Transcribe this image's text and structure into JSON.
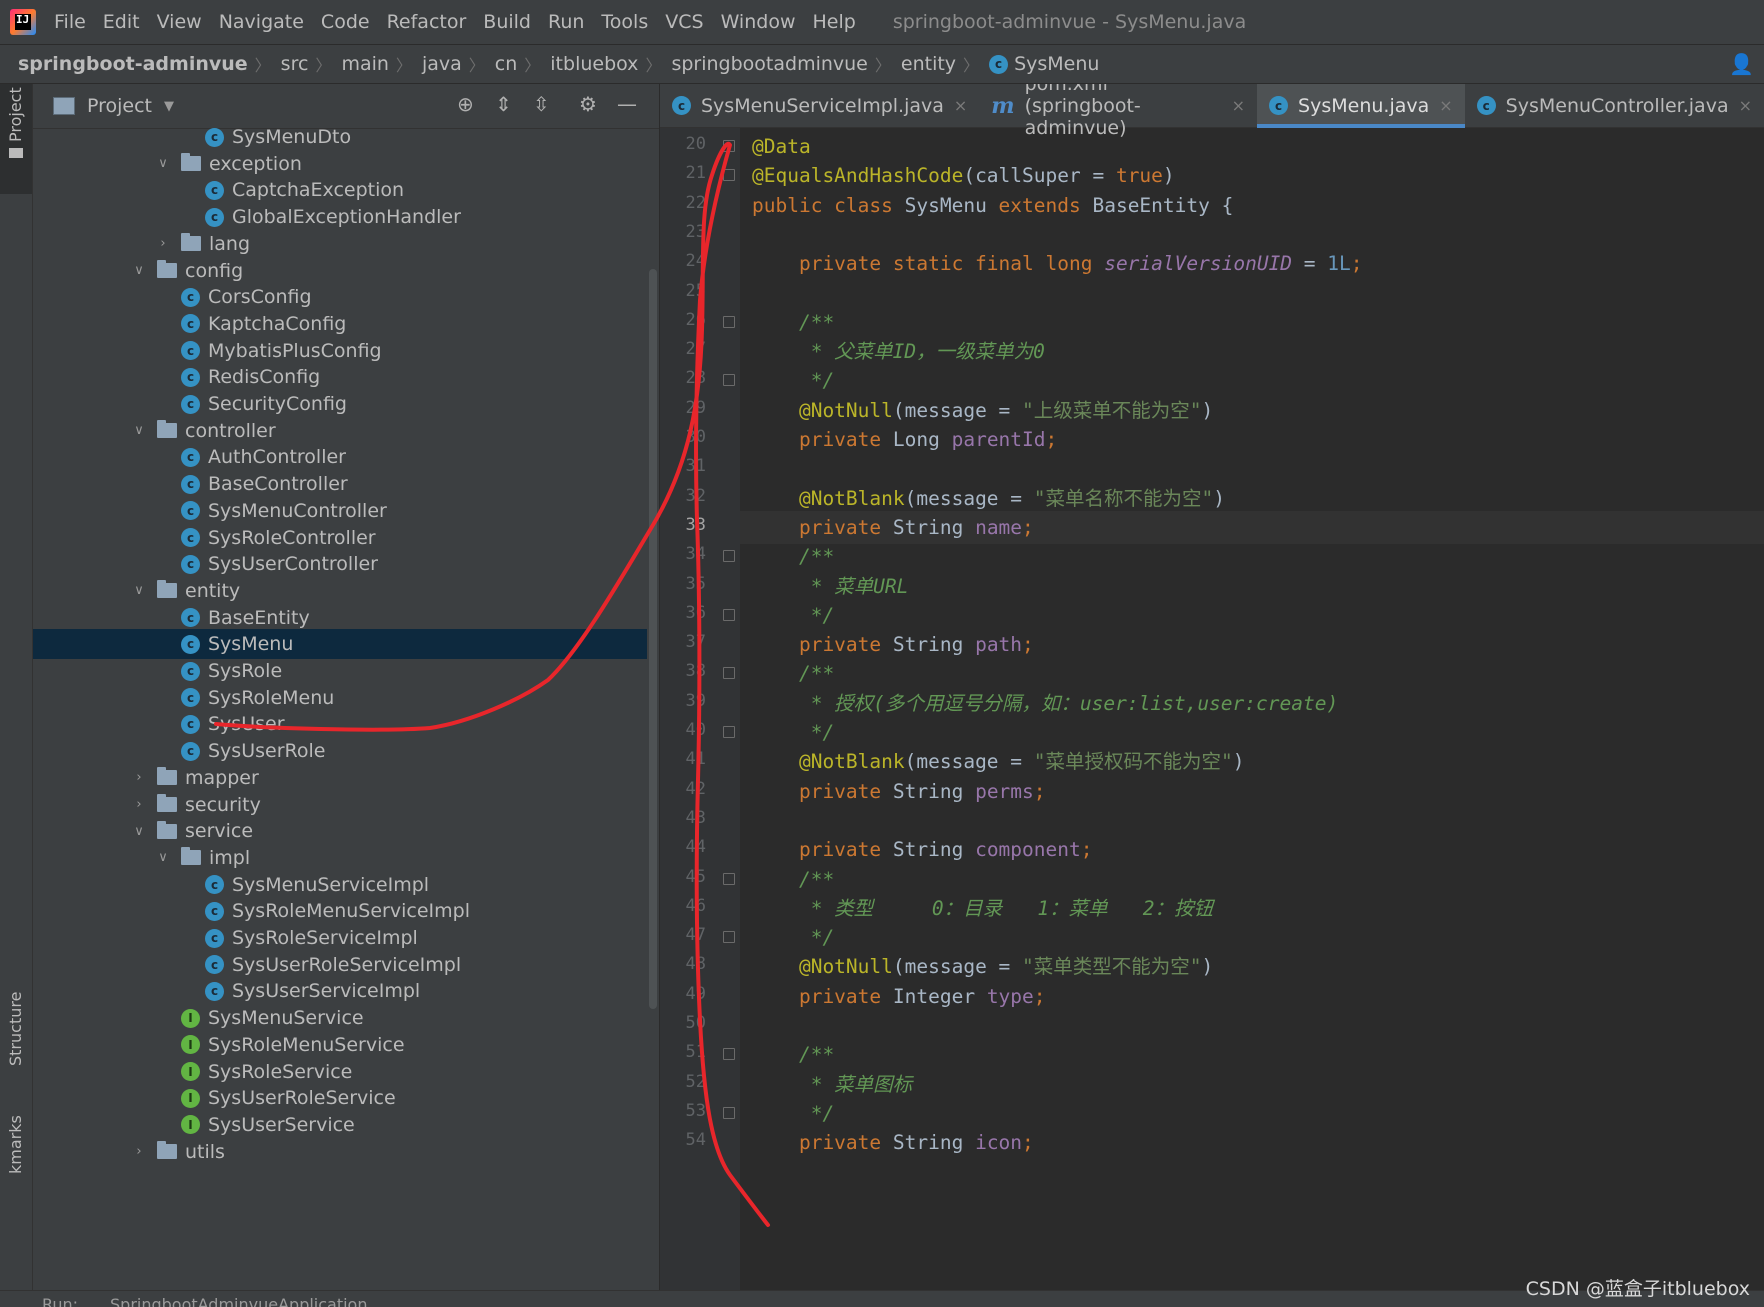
{
  "menu": {
    "items": [
      "File",
      "Edit",
      "View",
      "Navigate",
      "Code",
      "Refactor",
      "Build",
      "Run",
      "Tools",
      "VCS",
      "Window",
      "Help"
    ],
    "window_title": "springboot-adminvue - SysMenu.java"
  },
  "breadcrumb": [
    "springboot-adminvue",
    "src",
    "main",
    "java",
    "cn",
    "itbluebox",
    "springbootadminvue",
    "entity",
    "SysMenu"
  ],
  "tool_strip": {
    "project": "Project",
    "structure": "Structure",
    "bookmarks": "kmarks"
  },
  "project_panel": {
    "title": "Project"
  },
  "tree": [
    {
      "label": "SysMenuDto",
      "kind": "class",
      "depth": 3
    },
    {
      "label": "exception",
      "kind": "dir",
      "depth": 2,
      "expanded": true
    },
    {
      "label": "CaptchaException",
      "kind": "class",
      "depth": 3
    },
    {
      "label": "GlobalExceptionHandler",
      "kind": "class",
      "depth": 3
    },
    {
      "label": "lang",
      "kind": "dir",
      "depth": 2,
      "expanded": false
    },
    {
      "label": "config",
      "kind": "dir",
      "depth": 1,
      "expanded": true
    },
    {
      "label": "CorsConfig",
      "kind": "class",
      "depth": 2
    },
    {
      "label": "KaptchaConfig",
      "kind": "class",
      "depth": 2
    },
    {
      "label": "MybatisPlusConfig",
      "kind": "class",
      "depth": 2
    },
    {
      "label": "RedisConfig",
      "kind": "class",
      "depth": 2
    },
    {
      "label": "SecurityConfig",
      "kind": "class",
      "depth": 2
    },
    {
      "label": "controller",
      "kind": "dir",
      "depth": 1,
      "expanded": true
    },
    {
      "label": "AuthController",
      "kind": "class",
      "depth": 2
    },
    {
      "label": "BaseController",
      "kind": "class",
      "depth": 2
    },
    {
      "label": "SysMenuController",
      "kind": "class",
      "depth": 2
    },
    {
      "label": "SysRoleController",
      "kind": "class",
      "depth": 2
    },
    {
      "label": "SysUserController",
      "kind": "class",
      "depth": 2
    },
    {
      "label": "entity",
      "kind": "dir",
      "depth": 1,
      "expanded": true
    },
    {
      "label": "BaseEntity",
      "kind": "class",
      "depth": 2
    },
    {
      "label": "SysMenu",
      "kind": "class",
      "depth": 2,
      "selected": true
    },
    {
      "label": "SysRole",
      "kind": "class",
      "depth": 2
    },
    {
      "label": "SysRoleMenu",
      "kind": "class",
      "depth": 2
    },
    {
      "label": "SysUser",
      "kind": "class",
      "depth": 2
    },
    {
      "label": "SysUserRole",
      "kind": "class",
      "depth": 2
    },
    {
      "label": "mapper",
      "kind": "dir",
      "depth": 1,
      "expanded": false
    },
    {
      "label": "security",
      "kind": "dir",
      "depth": 1,
      "expanded": false
    },
    {
      "label": "service",
      "kind": "dir",
      "depth": 1,
      "expanded": true
    },
    {
      "label": "impl",
      "kind": "dir",
      "depth": 2,
      "expanded": true
    },
    {
      "label": "SysMenuServiceImpl",
      "kind": "class",
      "depth": 3
    },
    {
      "label": "SysRoleMenuServiceImpl",
      "kind": "class",
      "depth": 3
    },
    {
      "label": "SysRoleServiceImpl",
      "kind": "class",
      "depth": 3
    },
    {
      "label": "SysUserRoleServiceImpl",
      "kind": "class",
      "depth": 3
    },
    {
      "label": "SysUserServiceImpl",
      "kind": "class",
      "depth": 3
    },
    {
      "label": "SysMenuService",
      "kind": "interface",
      "depth": 2
    },
    {
      "label": "SysRoleMenuService",
      "kind": "interface",
      "depth": 2
    },
    {
      "label": "SysRoleService",
      "kind": "interface",
      "depth": 2
    },
    {
      "label": "SysUserRoleService",
      "kind": "interface",
      "depth": 2
    },
    {
      "label": "SysUserService",
      "kind": "interface",
      "depth": 2
    },
    {
      "label": "utils",
      "kind": "dir",
      "depth": 1,
      "expanded": false
    }
  ],
  "tabs": [
    {
      "label": "SysMenuServiceImpl.java",
      "icon": "class-icon",
      "active": false
    },
    {
      "label": "pom.xml (springboot-adminvue)",
      "icon": "maven-icon",
      "active": false
    },
    {
      "label": "SysMenu.java",
      "icon": "class-icon",
      "active": true
    },
    {
      "label": "SysMenuController.java",
      "icon": "class-icon",
      "active": false
    }
  ],
  "editor": {
    "current_line": 33,
    "lines": [
      {
        "n": 20,
        "tokens": [
          [
            "ann",
            "@Data"
          ]
        ]
      },
      {
        "n": 21,
        "tokens": [
          [
            "ann",
            "@EqualsAndHashCode"
          ],
          [
            "plain",
            "(callSuper = "
          ],
          [
            "kw",
            "true"
          ],
          [
            "plain",
            ")"
          ]
        ]
      },
      {
        "n": 22,
        "tokens": [
          [
            "kw",
            "public class "
          ],
          [
            "plain",
            "SysMenu "
          ],
          [
            "kw",
            "extends "
          ],
          [
            "plain",
            "BaseEntity {"
          ]
        ]
      },
      {
        "n": 23,
        "tokens": []
      },
      {
        "n": 24,
        "tokens": [
          [
            "kw",
            "    private static final long "
          ],
          [
            "sfld",
            "serialVersionUID"
          ],
          [
            "plain",
            " = "
          ],
          [
            "num",
            "1L"
          ],
          [
            "kw",
            ";"
          ]
        ]
      },
      {
        "n": 25,
        "tokens": []
      },
      {
        "n": 26,
        "tokens": [
          [
            "cm",
            "    /**"
          ]
        ]
      },
      {
        "n": 27,
        "tokens": [
          [
            "cm",
            "     * 父菜单ID，一级菜单为0"
          ]
        ]
      },
      {
        "n": 28,
        "tokens": [
          [
            "cm",
            "     */"
          ]
        ]
      },
      {
        "n": 29,
        "tokens": [
          [
            "ann",
            "    @NotNull"
          ],
          [
            "plain",
            "(message = "
          ],
          [
            "str",
            "\"上级菜单不能为空\""
          ],
          [
            "plain",
            ")"
          ]
        ]
      },
      {
        "n": 30,
        "tokens": [
          [
            "kw",
            "    private "
          ],
          [
            "plain",
            "Long "
          ],
          [
            "fld",
            "parentId"
          ],
          [
            "kw",
            ";"
          ]
        ]
      },
      {
        "n": 31,
        "tokens": []
      },
      {
        "n": 32,
        "tokens": [
          [
            "ann",
            "    @NotBlank"
          ],
          [
            "plain",
            "(message = "
          ],
          [
            "str",
            "\"菜单名称不能为空\""
          ],
          [
            "plain",
            ")"
          ]
        ]
      },
      {
        "n": 33,
        "tokens": [
          [
            "kw",
            "    private "
          ],
          [
            "plain",
            "String "
          ],
          [
            "fld",
            "name"
          ],
          [
            "kw",
            ";"
          ]
        ]
      },
      {
        "n": 34,
        "tokens": [
          [
            "cm",
            "    /**"
          ]
        ]
      },
      {
        "n": 35,
        "tokens": [
          [
            "cm",
            "     * 菜单URL"
          ]
        ]
      },
      {
        "n": 36,
        "tokens": [
          [
            "cm",
            "     */"
          ]
        ]
      },
      {
        "n": 37,
        "tokens": [
          [
            "kw",
            "    private "
          ],
          [
            "plain",
            "String "
          ],
          [
            "fld",
            "path"
          ],
          [
            "kw",
            ";"
          ]
        ]
      },
      {
        "n": 38,
        "tokens": [
          [
            "cm",
            "    /**"
          ]
        ]
      },
      {
        "n": 39,
        "tokens": [
          [
            "cm",
            "     * 授权(多个用逗号分隔，如：user:list,user:create)"
          ]
        ]
      },
      {
        "n": 40,
        "tokens": [
          [
            "cm",
            "     */"
          ]
        ]
      },
      {
        "n": 41,
        "tokens": [
          [
            "ann",
            "    @NotBlank"
          ],
          [
            "plain",
            "(message = "
          ],
          [
            "str",
            "\"菜单授权码不能为空\""
          ],
          [
            "plain",
            ")"
          ]
        ]
      },
      {
        "n": 42,
        "tokens": [
          [
            "kw",
            "    private "
          ],
          [
            "plain",
            "String "
          ],
          [
            "fld",
            "perms"
          ],
          [
            "kw",
            ";"
          ]
        ]
      },
      {
        "n": 43,
        "tokens": []
      },
      {
        "n": 44,
        "tokens": [
          [
            "kw",
            "    private "
          ],
          [
            "plain",
            "String "
          ],
          [
            "fld",
            "component"
          ],
          [
            "kw",
            ";"
          ]
        ]
      },
      {
        "n": 45,
        "tokens": [
          [
            "cm",
            "    /**"
          ]
        ]
      },
      {
        "n": 46,
        "tokens": [
          [
            "cm",
            "     * 类型     0：目录   1：菜单   2：按钮"
          ]
        ]
      },
      {
        "n": 47,
        "tokens": [
          [
            "cm",
            "     */"
          ]
        ]
      },
      {
        "n": 48,
        "tokens": [
          [
            "ann",
            "    @NotNull"
          ],
          [
            "plain",
            "(message = "
          ],
          [
            "str",
            "\"菜单类型不能为空\""
          ],
          [
            "plain",
            ")"
          ]
        ]
      },
      {
        "n": 49,
        "tokens": [
          [
            "kw",
            "    private "
          ],
          [
            "plain",
            "Integer "
          ],
          [
            "fld",
            "type"
          ],
          [
            "kw",
            ";"
          ]
        ]
      },
      {
        "n": 50,
        "tokens": []
      },
      {
        "n": 51,
        "tokens": [
          [
            "cm",
            "    /**"
          ]
        ]
      },
      {
        "n": 52,
        "tokens": [
          [
            "cm",
            "     * 菜单图标"
          ]
        ]
      },
      {
        "n": 53,
        "tokens": [
          [
            "cm",
            "     */"
          ]
        ]
      },
      {
        "n": 54,
        "tokens": [
          [
            "kw",
            "    private "
          ],
          [
            "plain",
            "String "
          ],
          [
            "fld",
            "icon"
          ],
          [
            "kw",
            ";"
          ]
        ]
      }
    ]
  },
  "bottom": {
    "run_label": "Run:",
    "run_config": "SpringbootAdminvueApplication"
  },
  "watermark": "CSDN @蓝盒子itbluebox",
  "colors": {
    "keyword": "#cc7832",
    "annotation": "#bbb529",
    "string": "#6a8759",
    "comment": "#629755",
    "field": "#9876aa",
    "number": "#6897bb",
    "selection": "#0d293e",
    "annotation_stroke": "#e8262b"
  }
}
